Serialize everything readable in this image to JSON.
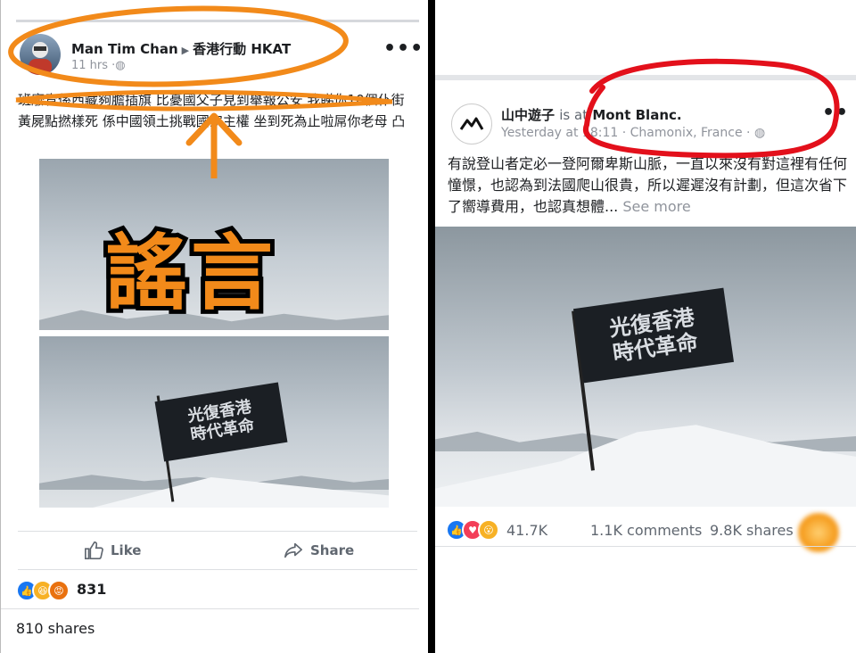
{
  "left_post": {
    "author": "Man Tim Chan",
    "group": "香港行動 HKAT",
    "time": "11 hrs",
    "text": "班廢青係西藏夠膽插旗 比憂國父子見到舉報公安 我睇你10個仆街黃屍點撚樣死 係中國領土挑戰國家主權 坐到死為止啦屌你老母 凸",
    "overlay_caption": "謠言",
    "flag_line1": "光復香港",
    "flag_line2": "時代革命",
    "like_label": "Like",
    "share_label": "Share",
    "reaction_count": "831",
    "shares_text": "810 shares"
  },
  "right_post": {
    "author": "山中遊子",
    "is_at": "is at",
    "place": "Mont Blanc.",
    "time": "Yesterday at 18:11",
    "location": "Chamonix, France",
    "text": "有說登山者定必一登阿爾卑斯山脈，一直以來沒有對這裡有任何憧憬，也認為到法國爬山很貴，所以遲遲沒有計劃，但這次省下了嚮導費用，也認真想體...",
    "see_more": "See more",
    "flag_line1": "光復香港",
    "flag_line2": "時代革命",
    "reaction_count": "41.7K",
    "comments": "1.1K comments",
    "shares": "9.8K shares"
  },
  "icons": [
    "globe-icon",
    "like-icon",
    "share-icon",
    "more-options-icon",
    "mountain-logo-icon",
    "avatar-icon"
  ],
  "colors": {
    "annotation": "#f28a1a",
    "circle_red": "#e3101b",
    "like_blue": "#1877f2",
    "facebook_text": "#1c1e21"
  }
}
